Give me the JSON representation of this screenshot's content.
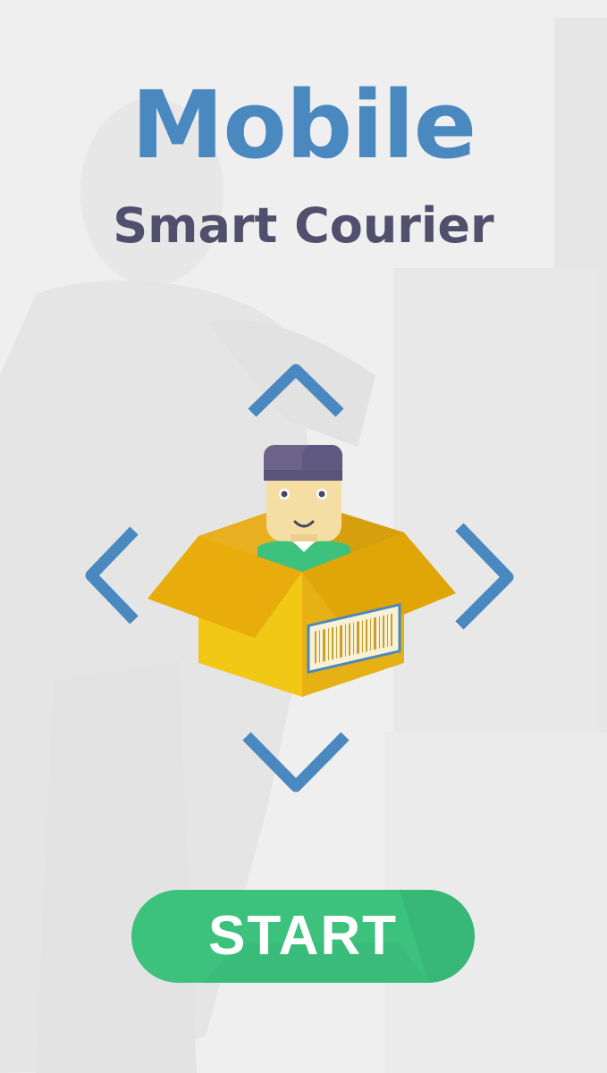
{
  "splash": {
    "title": "Mobile",
    "subtitle": "Smart Courier",
    "start_label": "START"
  },
  "colors": {
    "title": "#4a88c0",
    "subtitle": "#524f6c",
    "arrows": "#4a88c0",
    "start_button": "#3dc27e",
    "box": "#f0c418",
    "cap": "#5f5880",
    "shirt": "#3dc27e"
  },
  "icons": {
    "up": "chevron-up-icon",
    "down": "chevron-down-icon",
    "left": "chevron-left-icon",
    "right": "chevron-right-icon",
    "mascot": "courier-in-box-illustration"
  }
}
